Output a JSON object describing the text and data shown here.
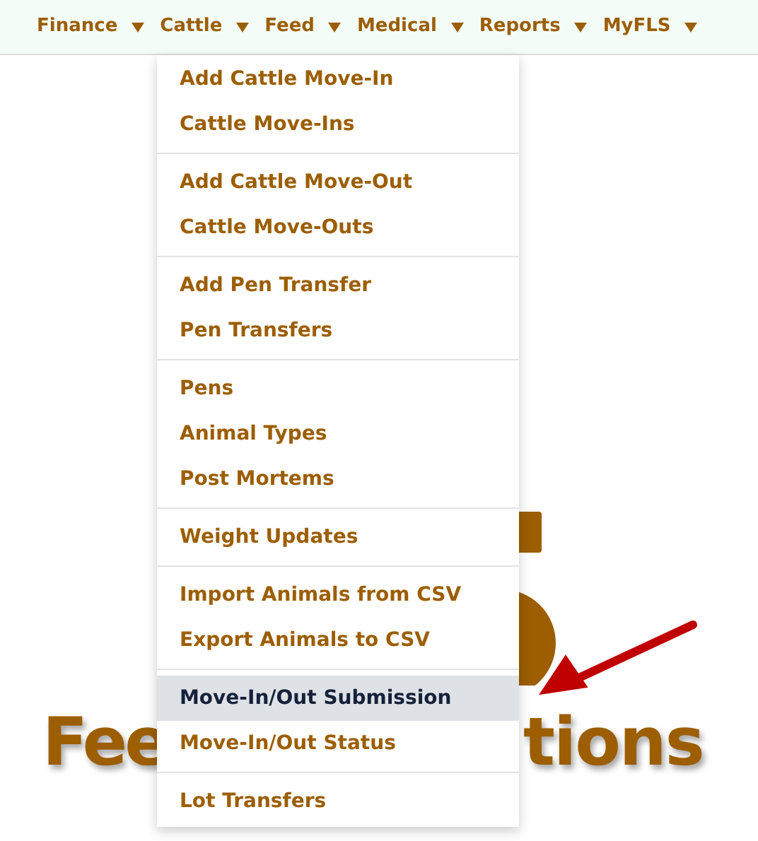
{
  "nav": [
    {
      "label": "Finance"
    },
    {
      "label": "Cattle"
    },
    {
      "label": "Feed"
    },
    {
      "label": "Medical"
    },
    {
      "label": "Reports"
    },
    {
      "label": "MyFLS"
    }
  ],
  "menu": {
    "groups": [
      [
        {
          "label": "Add Cattle Move-In",
          "selected": false
        },
        {
          "label": "Cattle Move-Ins",
          "selected": false
        }
      ],
      [
        {
          "label": "Add Cattle Move-Out",
          "selected": false
        },
        {
          "label": "Cattle Move-Outs",
          "selected": false
        }
      ],
      [
        {
          "label": "Add Pen Transfer",
          "selected": false
        },
        {
          "label": "Pen Transfers",
          "selected": false
        }
      ],
      [
        {
          "label": "Pens",
          "selected": false
        },
        {
          "label": "Animal Types",
          "selected": false
        },
        {
          "label": "Post Mortems",
          "selected": false
        }
      ],
      [
        {
          "label": "Weight Updates",
          "selected": false
        }
      ],
      [
        {
          "label": "Import Animals from CSV",
          "selected": false
        },
        {
          "label": "Export Animals to CSV",
          "selected": false
        }
      ],
      [
        {
          "label": "Move-In/Out Submission",
          "selected": true
        },
        {
          "label": "Move-In/Out Status",
          "selected": false
        }
      ],
      [
        {
          "label": "Lot Transfers",
          "selected": false
        }
      ]
    ]
  },
  "logo": {
    "left_text": "Fee",
    "right_text": "tions"
  }
}
